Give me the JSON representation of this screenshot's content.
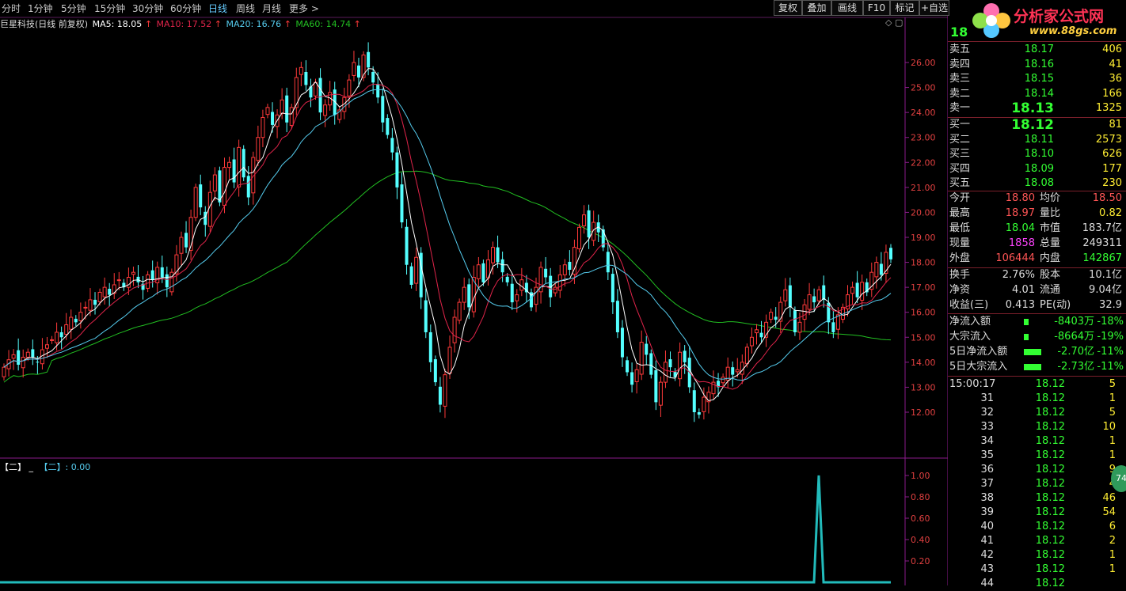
{
  "toolbar": {
    "tabs": [
      "分时",
      "1分钟",
      "5分钟",
      "15分钟",
      "30分钟",
      "60分钟",
      "日线",
      "周线",
      "月线",
      "更多 >"
    ],
    "active_tab": "日线",
    "right_buttons": [
      "复权",
      "叠加",
      "画线",
      "F10",
      "标记",
      "+自选"
    ]
  },
  "title": {
    "stock": "巨星科技(日线 前复权)",
    "ma5": "MA5: 18.05",
    "ma10": "MA10: 17.52",
    "ma20": "MA20: 16.76",
    "ma60": "MA60: 14.74"
  },
  "colors": {
    "up": "#ff3a3a",
    "down": "#54ffff",
    "ma5": "#ffffff",
    "ma10": "#e0244a",
    "ma20": "#55ccee",
    "ma60": "#22c022",
    "grid": "#8a1a8a"
  },
  "price_axis": [
    "26.00",
    "25.00",
    "24.00",
    "23.00",
    "22.00",
    "21.00",
    "20.00",
    "19.00",
    "18.00",
    "17.00",
    "16.00",
    "15.00",
    "14.00",
    "13.00",
    "12.00"
  ],
  "indicator": {
    "label1": "【二】",
    "label2": "【二】: 0.00",
    "axis": [
      "1.00",
      "0.80",
      "0.60",
      "0.40",
      "0.20"
    ]
  },
  "chart_data": {
    "type": "candlestick",
    "ylim": [
      11.0,
      27.0
    ],
    "closes": [
      13.8,
      14.1,
      14.3,
      13.9,
      14.2,
      14.4,
      14.2,
      14.0,
      14.5,
      14.7,
      14.9,
      15.2,
      15.0,
      15.5,
      15.8,
      15.6,
      16.0,
      16.2,
      16.5,
      16.3,
      16.8,
      17.0,
      16.7,
      17.1,
      17.3,
      17.0,
      17.4,
      17.6,
      17.2,
      16.9,
      17.5,
      17.3,
      17.8,
      17.4,
      17.0,
      17.6,
      18.3,
      19.0,
      18.6,
      19.8,
      21.0,
      20.2,
      19.5,
      20.8,
      21.5,
      20.4,
      21.8,
      22.0,
      21.2,
      22.6,
      21.4,
      20.6,
      22.2,
      23.0,
      23.8,
      24.2,
      23.5,
      23.9,
      24.5,
      23.6,
      24.2,
      25.4,
      25.8,
      25.1,
      24.6,
      25.2,
      24.0,
      24.3,
      24.8,
      23.9,
      24.1,
      24.6,
      25.3,
      26.0,
      25.4,
      26.3,
      25.8,
      25.2,
      24.6,
      23.6,
      23.1,
      22.4,
      21.0,
      19.6,
      17.9,
      17.1,
      18.2,
      16.6,
      15.2,
      14.0,
      13.2,
      12.3,
      13.5,
      14.6,
      15.8,
      16.4,
      17.0,
      16.2,
      17.4,
      17.9,
      17.2,
      18.1,
      18.6,
      18.0,
      17.6,
      17.2,
      16.4,
      16.7,
      17.3,
      16.8,
      16.2,
      17.0,
      17.8,
      17.4,
      16.6,
      17.0,
      17.5,
      17.9,
      17.7,
      18.6,
      19.4,
      19.9,
      19.0,
      19.6,
      19.2,
      18.6,
      17.6,
      16.4,
      15.2,
      14.2,
      13.6,
      13.1,
      13.7,
      14.8,
      14.3,
      13.5,
      12.4,
      13.2,
      14.0,
      13.8,
      13.4,
      14.4,
      14.0,
      13.0,
      12.0,
      11.9,
      12.6,
      12.8,
      13.2,
      13.0,
      13.4,
      13.8,
      13.5,
      13.7,
      14.0,
      14.6,
      15.0,
      15.3,
      15.0,
      15.6,
      16.0,
      15.7,
      16.4,
      16.9,
      16.2,
      15.2,
      15.6,
      16.3,
      16.7,
      16.4,
      16.9,
      16.5,
      15.6,
      15.2,
      15.9,
      16.2,
      16.7,
      17.0,
      16.6,
      17.2,
      16.8,
      17.6,
      18.0,
      17.5,
      18.4,
      18.12
    ],
    "ma_series": [
      "MA5",
      "MA10",
      "MA20",
      "MA60"
    ]
  },
  "indicator_data": {
    "spike_index": 173,
    "spike_value": 1.0,
    "base_value": 0.0
  },
  "quote": {
    "code_fragment": "18",
    "ask": [
      {
        "label": "卖五",
        "price": "18.17",
        "vol": "406"
      },
      {
        "label": "卖四",
        "price": "18.16",
        "vol": "41"
      },
      {
        "label": "卖三",
        "price": "18.15",
        "vol": "36"
      },
      {
        "label": "卖二",
        "price": "18.14",
        "vol": "166"
      },
      {
        "label": "卖一",
        "price": "18.13",
        "vol": "1325"
      }
    ],
    "bid": [
      {
        "label": "买一",
        "price": "18.12",
        "vol": "81"
      },
      {
        "label": "买二",
        "price": "18.11",
        "vol": "2573"
      },
      {
        "label": "买三",
        "price": "18.10",
        "vol": "626"
      },
      {
        "label": "买四",
        "price": "18.09",
        "vol": "177"
      },
      {
        "label": "买五",
        "price": "18.08",
        "vol": "230"
      }
    ],
    "stats": [
      {
        "l1": "今开",
        "v1": "18.80",
        "c1": "red",
        "l2": "均价",
        "v2": "18.50",
        "c2": "red"
      },
      {
        "l1": "最高",
        "v1": "18.97",
        "c1": "red",
        "l2": "量比",
        "v2": "0.82",
        "c2": "yel"
      },
      {
        "l1": "最低",
        "v1": "18.04",
        "c1": "green",
        "l2": "市值",
        "v2": "183.7亿",
        "c2": "wht"
      },
      {
        "l1": "现量",
        "v1": "1858",
        "c1": "purp",
        "l2": "总量",
        "v2": "249311",
        "c2": "wht"
      },
      {
        "l1": "外盘",
        "v1": "106444",
        "c1": "red",
        "l2": "内盘",
        "v2": "142867",
        "c2": "green"
      }
    ],
    "stats2": [
      {
        "l1": "换手",
        "v1": "2.76%",
        "l2": "股本",
        "v2": "10.1亿"
      },
      {
        "l1": "净资",
        "v1": "4.01",
        "l2": "流通",
        "v2": "9.04亿"
      },
      {
        "l1": "收益(三)",
        "v1": "0.413",
        "l2": "PE(动)",
        "v2": "32.9"
      }
    ],
    "flows": [
      {
        "label": "净流入额",
        "value": "-8403万",
        "pct": "-18%",
        "bar": 0.15
      },
      {
        "label": "大宗流入",
        "value": "-8664万",
        "pct": "-19%",
        "bar": 0.15
      },
      {
        "label": "5日净流入额",
        "value": "-2.70亿",
        "pct": "-11%",
        "bar": 0.55
      },
      {
        "label": "5日大宗流入",
        "value": "-2.73亿",
        "pct": "-11%",
        "bar": 0.55
      }
    ],
    "ticks": [
      {
        "t": "15:00:17",
        "p": "18.12",
        "v": "5"
      },
      {
        "t": "31",
        "p": "18.12",
        "v": "1"
      },
      {
        "t": "32",
        "p": "18.12",
        "v": "5"
      },
      {
        "t": "33",
        "p": "18.12",
        "v": "10"
      },
      {
        "t": "34",
        "p": "18.12",
        "v": "1"
      },
      {
        "t": "35",
        "p": "18.12",
        "v": "1"
      },
      {
        "t": "36",
        "p": "18.12",
        "v": "9"
      },
      {
        "t": "37",
        "p": "18.12",
        "v": "4"
      },
      {
        "t": "38",
        "p": "18.12",
        "v": "46"
      },
      {
        "t": "39",
        "p": "18.12",
        "v": "54"
      },
      {
        "t": "40",
        "p": "18.12",
        "v": "6"
      },
      {
        "t": "41",
        "p": "18.12",
        "v": "2"
      },
      {
        "t": "42",
        "p": "18.12",
        "v": "1"
      },
      {
        "t": "43",
        "p": "18.12",
        "v": "1"
      },
      {
        "t": "44",
        "p": "18.12",
        "v": ""
      }
    ]
  },
  "logo": {
    "text": "分析家公式网",
    "url": "www.88gs.com",
    "badge": "74"
  }
}
